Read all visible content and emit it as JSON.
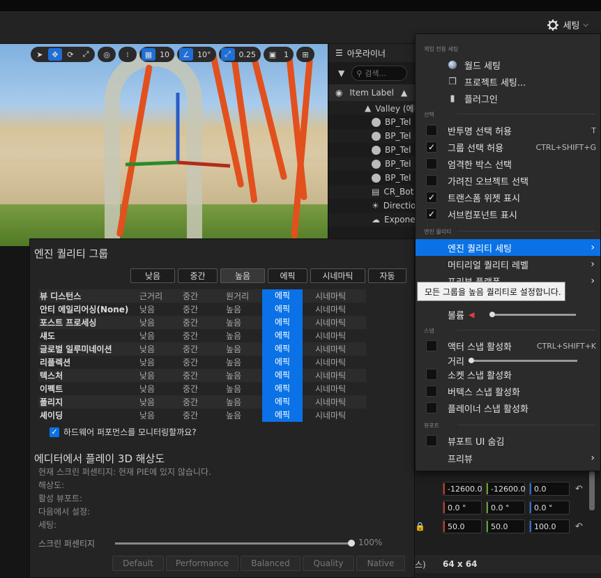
{
  "toolbar": {
    "settings_label": "세팅"
  },
  "viewport": {
    "snap_grid": "10",
    "snap_rotate": "10°",
    "snap_scale": "0.25",
    "camera_speed": "1"
  },
  "outliner": {
    "title": "아웃라이너",
    "search_placeholder": "검색...",
    "column": "Item Label",
    "rows": [
      "Valley (에디",
      "BP_Tel",
      "BP_Tel",
      "BP_Tel",
      "BP_Tel",
      "BP_Tel",
      "CR_Bot",
      "Directio",
      "Expone"
    ]
  },
  "quality": {
    "title": "엔진 퀄리티 그룹",
    "buttons": [
      "낮음",
      "중간",
      "높음",
      "에픽",
      "시네마틱",
      "자동"
    ],
    "rows": [
      {
        "name": "뷰 디스턴스",
        "c": [
          "근거리",
          "중간",
          "원거리",
          "에픽",
          "시네마틱"
        ]
      },
      {
        "name": "안티 에일리어싱(None)",
        "c": [
          "낮음",
          "중간",
          "높음",
          "에픽",
          "시네마틱"
        ]
      },
      {
        "name": "포스트 프로세싱",
        "c": [
          "낮음",
          "중간",
          "높음",
          "에픽",
          "시네마틱"
        ]
      },
      {
        "name": "섀도",
        "c": [
          "낮음",
          "중간",
          "높음",
          "에픽",
          "시네마틱"
        ]
      },
      {
        "name": "글로벌 일루미네이션",
        "c": [
          "낮음",
          "중간",
          "높음",
          "에픽",
          "시네마틱"
        ]
      },
      {
        "name": "리플렉션",
        "c": [
          "낮음",
          "중간",
          "높음",
          "에픽",
          "시네마틱"
        ]
      },
      {
        "name": "텍스처",
        "c": [
          "낮음",
          "중간",
          "높음",
          "에픽",
          "시네마틱"
        ]
      },
      {
        "name": "이펙트",
        "c": [
          "낮음",
          "중간",
          "높음",
          "에픽",
          "시네마틱"
        ]
      },
      {
        "name": "폴리지",
        "c": [
          "낮음",
          "중간",
          "높음",
          "에픽",
          "시네마틱"
        ]
      },
      {
        "name": "셰이딩",
        "c": [
          "낮음",
          "중간",
          "높음",
          "에픽",
          "시네마틱"
        ]
      }
    ],
    "monitor_label": "하드웨어 퍼포먼스를 모니터링할까요?",
    "play_title": "에디터에서 플레이 3D 해상도",
    "info": [
      "현재 스크린 퍼센티지: 현재 PIE에 있지 않습니다.",
      "해상도:",
      "활성 뷰포트:",
      "다음에서 설정:",
      "세팅:"
    ],
    "screen_pct_label": "스크린 퍼센티지",
    "screen_pct_value": "100%",
    "screen_pct": 1.0,
    "presets": [
      "Default",
      "Performance",
      "Balanced",
      "Quality",
      "Native"
    ]
  },
  "details": {
    "loc": [
      "-12600.0",
      "-12600.0",
      "0.0"
    ],
    "rot": [
      "0.0 °",
      "0.0 °",
      "0.0 °"
    ],
    "scale": [
      "50.0",
      "50.0",
      "100.0"
    ],
    "res_label": "스)",
    "res_value": "64 x 64"
  },
  "menu": {
    "sec_game": "게임 전용 세팅",
    "world": "월드 세팅",
    "project": "프로젝트 세팅...",
    "plugins": "플러그인",
    "sec_select": "선택",
    "translucent": "반투명 선택 허용",
    "translucent_sc": "T",
    "group": "그룹 선택 허용",
    "group_sc": "CTRL+SHIFT+G",
    "strict": "엄격한 박스 선택",
    "occluded": "가려진 오브젝트 선택",
    "transform": "트랜스폼 위젯 표시",
    "subcomp": "서브컴포넌트 표시",
    "sec_engine": "엔진 퀄리티",
    "engine_quality": "엔진 퀄리티 세팅",
    "material_quality": "머티리얼 퀄리티 레벨",
    "feature_level": "프리뷰 플랫폼",
    "volume": "볼륨",
    "volume_level": 0.0,
    "sec_snap": "스냅",
    "actor_snap": "액터 스냅 활성화",
    "actor_snap_sc": "CTRL+SHIFT+K",
    "distance": "거리",
    "distance_level": 0.0,
    "socket_snap": "소켓 스냅 활성화",
    "vertex_snap": "버텍스 스냅 활성화",
    "plane_snap": "플레이너 스냅 활성화",
    "sec_viewport": "뷰포트",
    "hide_ui": "뷰포트 UI 숨김",
    "preview": "프리뷰"
  },
  "tooltip": "모든 그룹을 높음 퀄리티로 설정합니다."
}
